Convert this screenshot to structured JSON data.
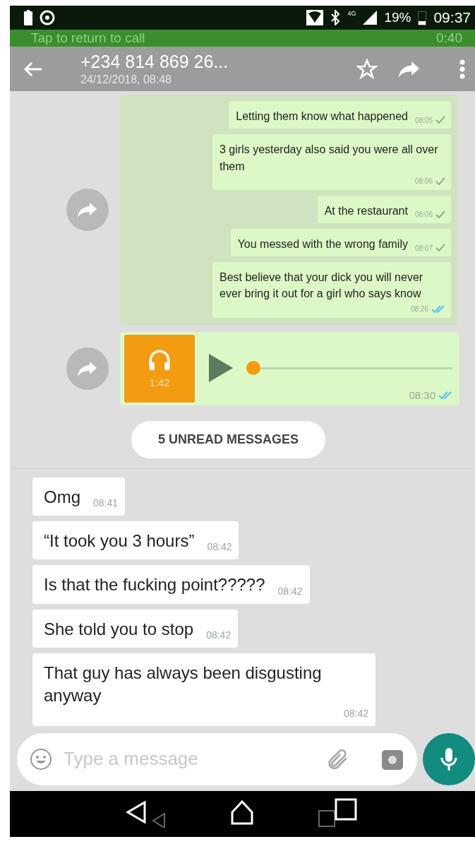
{
  "status_bar": {
    "network": "4G",
    "battery": "19%",
    "time": "09:37"
  },
  "call_bar": {
    "text": "Tap to return to call",
    "duration": "0:40"
  },
  "header": {
    "title": "+234 814 869 26...",
    "subtitle": "24/12/2018, 08:48"
  },
  "forwarded_messages": [
    {
      "text": "Letting them know what happened",
      "time": "08:05",
      "read": false
    },
    {
      "text": "3 girls yesterday also said you were all over them",
      "time": "08:06",
      "read": false
    },
    {
      "text": "At the restaurant",
      "time": "08:06",
      "read": false
    },
    {
      "text": "You messed with the wrong family",
      "time": "08:07",
      "read": false
    },
    {
      "text": "Best believe that your dick you will never ever bring it out for a girl who says know",
      "time": "08:26",
      "read": true
    }
  ],
  "voice_message": {
    "duration": "1:42",
    "time": "08:30",
    "read": true,
    "level": 0.03
  },
  "unread_banner": "5 UNREAD MESSAGES",
  "incoming_messages": [
    {
      "text": "Omg",
      "time": "08:41"
    },
    {
      "text": "“It took you 3 hours”",
      "time": "08:42"
    },
    {
      "text": "Is that the fucking point?????",
      "time": "08:42"
    },
    {
      "text": "She told you to stop",
      "time": "08:42"
    },
    {
      "text": "That guy has always been disgusting anyway",
      "time": "08:42"
    }
  ],
  "composer": {
    "placeholder": "Type a message"
  }
}
